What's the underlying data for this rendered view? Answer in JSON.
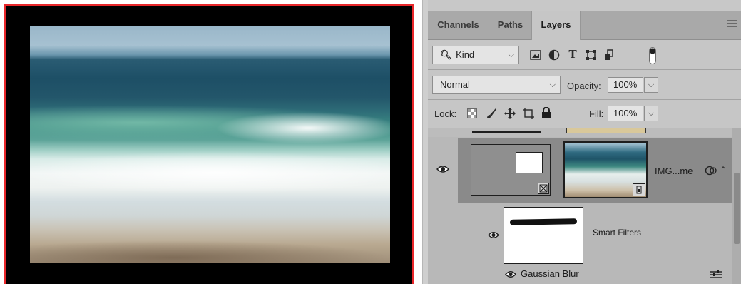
{
  "panel": {
    "tabs": [
      {
        "label": "Channels",
        "active": false
      },
      {
        "label": "Paths",
        "active": false
      },
      {
        "label": "Layers",
        "active": true
      }
    ],
    "filter": {
      "kind_label": "Kind",
      "icons": [
        "pixel-filter-icon",
        "adjustment-filter-icon",
        "type-filter-icon",
        "shape-filter-icon",
        "smart-object-filter-icon",
        "filter-toggle-icon"
      ]
    },
    "blend": {
      "mode": "Normal",
      "opacity_label": "Opacity:",
      "opacity_value": "100%"
    },
    "lock": {
      "label": "Lock:",
      "fill_label": "Fill:",
      "fill_value": "100%"
    },
    "layers": {
      "smart_object": {
        "name": "IMG...me",
        "visible": true
      },
      "smart_filters": {
        "label": "Smart Filters",
        "visible": true
      },
      "filters": [
        {
          "name": "Gaussian Blur",
          "visible": true
        }
      ]
    }
  },
  "colors": {
    "canvas_border": "#e8262a",
    "panel_bg": "#b8b8b8",
    "selected_layer": "#8a8a8a"
  }
}
